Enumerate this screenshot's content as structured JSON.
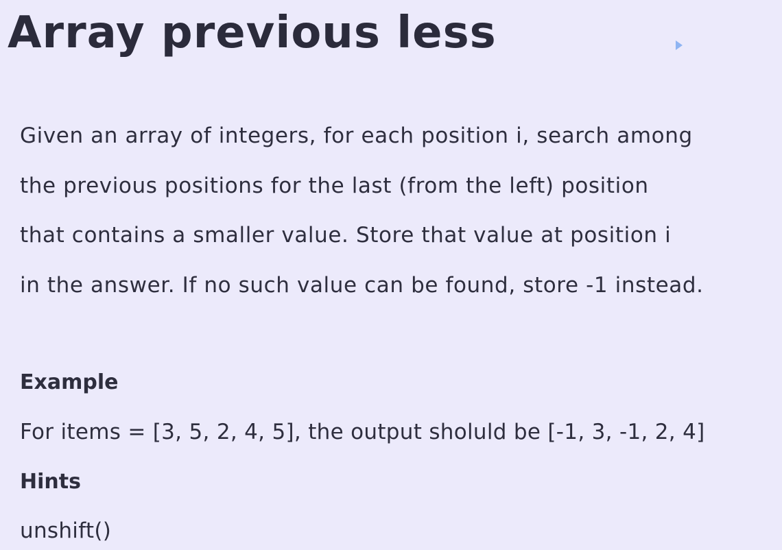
{
  "title": "Array previous less",
  "description": {
    "lines": [
      "Given an array of integers, for each position i, search among",
      "the previous positions for the last (from the left) position",
      "that contains a smaller value. Store that value at position i",
      "in the answer. If no such value can be found, store -1 instead."
    ]
  },
  "example": {
    "heading": "Example",
    "text": "For items = [3, 5, 2, 4, 5], the output sholuld be [-1, 3, -1, 2, 4]"
  },
  "hints": {
    "heading": "Hints",
    "text": "unshift()"
  },
  "colors": {
    "background": "#ECEAFB",
    "text": "#2E2E3E",
    "cursor": "#8FB4F2"
  },
  "icons": {
    "cursor": "mouse-pointer-icon"
  }
}
